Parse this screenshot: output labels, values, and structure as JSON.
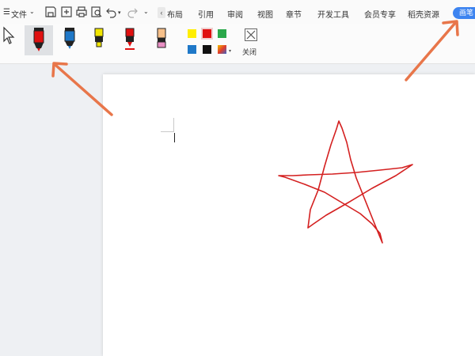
{
  "menu": {
    "file": "文件",
    "tabs": [
      "布局",
      "引用",
      "审阅",
      "视图",
      "章节",
      "开发工具",
      "会员专享",
      "稻壳资源"
    ],
    "active_tab": "画笔"
  },
  "toolbar": {
    "close_label": "关闭",
    "pens": [
      {
        "icon": "red-marker-icon",
        "color": "#e01010"
      },
      {
        "icon": "blue-marker-icon",
        "color": "#1f78c8"
      },
      {
        "icon": "yellow-highlighter-icon",
        "color": "#f2e600"
      },
      {
        "icon": "red-pen-icon",
        "color": "#e01010"
      },
      {
        "icon": "eraser-icon",
        "color": "#f6c08a"
      }
    ],
    "colors": [
      "#ffee00",
      "#e01010",
      "#2aa84a",
      "#1f78c8",
      "#111111",
      "#3a66c8"
    ],
    "selected_color": "#e01010"
  },
  "annotation_color": "#e8764a",
  "ink_color": "#d42020"
}
